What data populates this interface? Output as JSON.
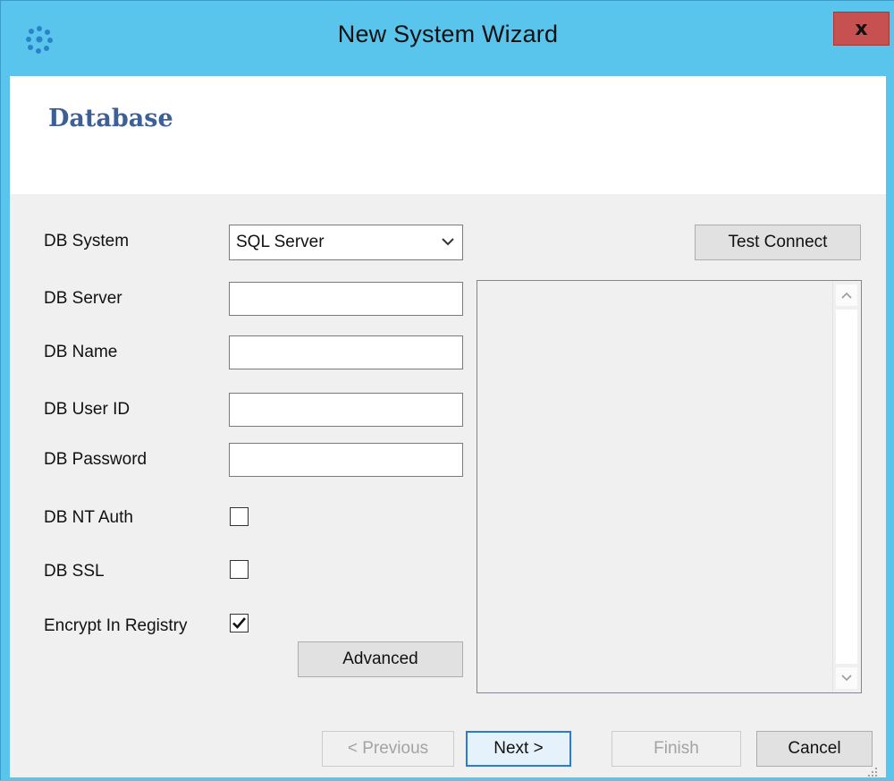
{
  "window": {
    "title": "New System Wizard",
    "close_glyph": "x",
    "app_icon": "dots-cluster-icon",
    "colors": {
      "frame": "#59c4ec",
      "close": "#c75050",
      "heading": "#3c5f97"
    }
  },
  "header": {
    "title": "Database"
  },
  "form": {
    "db_system": {
      "label": "DB System",
      "value": "SQL Server"
    },
    "db_server": {
      "label": "DB Server",
      "value": ""
    },
    "db_name": {
      "label": "DB Name",
      "value": ""
    },
    "db_user_id": {
      "label": "DB User ID",
      "value": ""
    },
    "db_password": {
      "label": "DB Password",
      "value": ""
    },
    "db_nt_auth": {
      "label": "DB NT Auth",
      "checked": false
    },
    "db_ssl": {
      "label": "DB SSL",
      "checked": false
    },
    "encrypt_in_registry": {
      "label": "Encrypt In Registry",
      "checked": true
    },
    "advanced_button": "Advanced"
  },
  "test_connect_button": "Test Connect",
  "footer": {
    "previous": "< Previous",
    "next": "Next >",
    "finish": "Finish",
    "cancel": "Cancel"
  }
}
